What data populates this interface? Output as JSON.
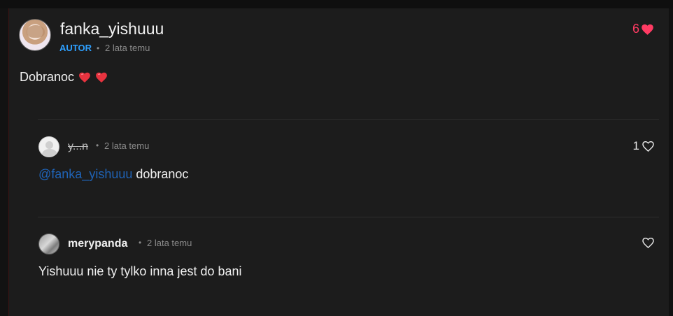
{
  "post": {
    "author": "fanka_yishuuu",
    "badge": "AUTOR",
    "separator": "•",
    "time": "2 lata temu",
    "text": "Dobranoc",
    "likes": "6",
    "colors": {
      "like": "#ff3b63",
      "badge": "#2ea0ff",
      "mention": "#1f63b6"
    }
  },
  "replies": [
    {
      "author": "y...n",
      "time": "2 lata temu",
      "mention": "@fanka_yishuuu",
      "text": "dobranoc",
      "likes": "1"
    },
    {
      "author": "merypanda",
      "time": "2 lata temu",
      "text": "Yishuuu nie ty tylko inna jest do bani",
      "likes": ""
    }
  ],
  "icons": {
    "like_filled": "heart-filled-icon",
    "like_outline": "heart-outline-icon",
    "emoji": "red-heart-emoji-icon"
  }
}
